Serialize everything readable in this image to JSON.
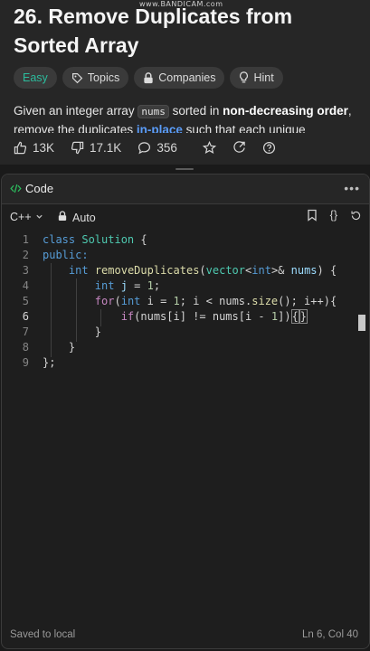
{
  "watermark": "www.BANDICAM.com",
  "problem": {
    "title": "26. Remove Duplicates from Sorted Array",
    "tags": [
      {
        "label": "Easy",
        "icon": ""
      },
      {
        "label": "Topics",
        "icon": "tag-icon"
      },
      {
        "label": "Companies",
        "icon": "lock-icon"
      },
      {
        "label": "Hint",
        "icon": "lightbulb-icon"
      }
    ],
    "description": {
      "t1": "Given an integer array ",
      "code1": "nums",
      "t2": " sorted in ",
      "b1": "non-decreasing order",
      "t3": ", remove the duplicates ",
      "link1": "in-place",
      "t4": " such that each unique"
    },
    "stats": {
      "likes": "13K",
      "dislikes": "17.1K",
      "comments": "356"
    }
  },
  "code_panel": {
    "header_label": "Code",
    "language": "C++",
    "autocomplete": "Auto",
    "lines": [
      {
        "n": "1"
      },
      {
        "n": "2"
      },
      {
        "n": "3"
      },
      {
        "n": "4"
      },
      {
        "n": "5"
      },
      {
        "n": "6"
      },
      {
        "n": "7"
      },
      {
        "n": "8"
      },
      {
        "n": "9"
      }
    ],
    "code": {
      "l1_kw": "class",
      "l1_cls": "Solution",
      "l1_rest": " {",
      "l2_kw": "public:",
      "l3_type": "int",
      "l3_fn": "removeDuplicates",
      "l3_a": "(",
      "l3_vec": "vector",
      "l3_b": "<",
      "l3_int": "int",
      "l3_c": ">& ",
      "l3_var": "nums",
      "l3_d": ") {",
      "l4_type": "int",
      "l4_var": "j",
      "l4_eq": " = ",
      "l4_num": "1",
      "l4_end": ";",
      "l5_ctl": "for",
      "l5_a": "(",
      "l5_type": "int",
      "l5_b": " i = ",
      "l5_num": "1",
      "l5_c": "; i < nums.",
      "l5_fn": "size",
      "l5_d": "(); i++){",
      "l6_ctl": "if",
      "l6_a": "(nums[i] != nums[i - ",
      "l6_num": "1",
      "l6_b": "])",
      "l6_br1": "{",
      "l6_br2": "}",
      "l7": "}",
      "l8": "}",
      "l9": "};"
    },
    "status": {
      "saved": "Saved to local",
      "cursor": "Ln 6, Col 40"
    }
  }
}
